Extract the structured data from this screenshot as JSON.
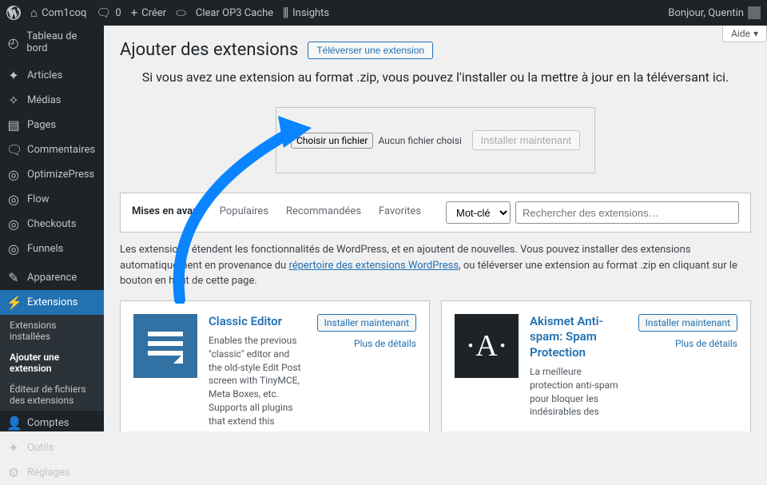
{
  "adminbar": {
    "site": "Com1coq",
    "comments": "0",
    "create": "Créer",
    "clear_cache": "Clear OP3 Cache",
    "insights": "Insights",
    "greeting": "Bonjour, Quentin"
  },
  "sidebar": {
    "dashboard": "Tableau de bord",
    "posts": "Articles",
    "media": "Médias",
    "pages": "Pages",
    "comments": "Commentaires",
    "optimizepress": "OptimizePress",
    "flow": "Flow",
    "checkouts": "Checkouts",
    "funnels": "Funnels",
    "appearance": "Apparence",
    "plugins": "Extensions",
    "plugins_installed": "Extensions installées",
    "plugins_add": "Ajouter une extension",
    "plugins_editor": "Éditeur de fichiers des extensions",
    "users": "Comptes",
    "tools": "Outils",
    "settings": "Réglages"
  },
  "page": {
    "title": "Ajouter des extensions",
    "upload_btn": "Téléverser une extension",
    "help": "Aide",
    "lead": "Si vous avez une extension au format .zip, vous pouvez l'installer ou la mettre à jour en la téléversant ici.",
    "choose_file": "Choisir un fichier",
    "no_file": "Aucun fichier choisi",
    "install_now_disabled": "Installer maintenant",
    "tabs": {
      "featured": "Mises en avant",
      "popular": "Populaires",
      "recommended": "Recommandées",
      "favorites": "Favorites"
    },
    "search": {
      "keyword": "Mot-clé",
      "placeholder": "Rechercher des extensions…"
    },
    "desc_1": "Les extensions étendent les fonctionnalités de WordPress, et en ajoutent de nouvelles. Vous pouvez installer des extensions automatiquement en provenance du ",
    "desc_link": "répertoire des extensions WordPress",
    "desc_2": ", ou téléverser une extension au format .zip en cliquant sur le bouton en haut de cette page.",
    "plugin1": {
      "title": "Classic Editor",
      "desc": "Enables the previous \"classic\" editor and the old-style Edit Post screen with TinyMCE, Meta Boxes, etc. Supports all plugins that extend this",
      "install": "Installer maintenant",
      "details": "Plus de détails"
    },
    "plugin2": {
      "title": "Akismet Anti-spam: Spam Protection",
      "desc": "La meilleure protection anti-spam pour bloquer les indésirables des",
      "install": "Installer maintenant",
      "details": "Plus de détails"
    }
  }
}
